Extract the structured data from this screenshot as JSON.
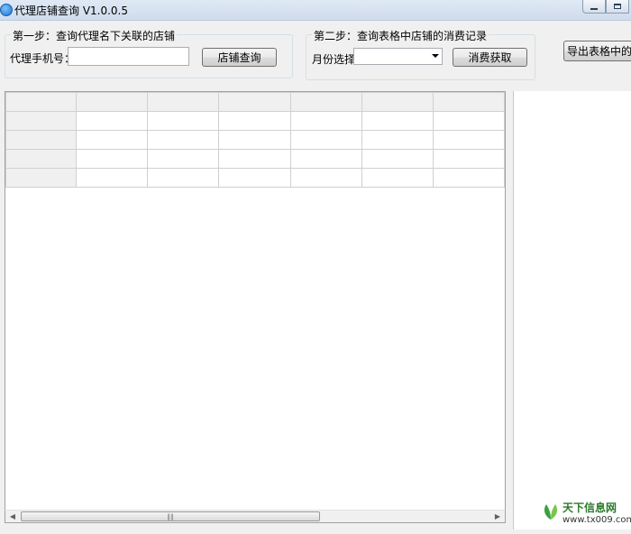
{
  "window": {
    "title": "代理店铺查询 V1.0.0.5"
  },
  "step1": {
    "title": "第一步：查询代理名下关联的店铺",
    "phone_label": "代理手机号：",
    "phone_value": "",
    "query_button": "店铺查询"
  },
  "step2": {
    "title": "第二步：查询表格中店铺的消费记录",
    "month_label": "月份选择",
    "month_value": "",
    "fetch_button": "消费获取"
  },
  "export_button": "导出表格中的数",
  "grid": {
    "columns": 7,
    "data_rows": 4
  },
  "watermark": {
    "title": "天下信息网",
    "url": "www.tx009.com"
  }
}
